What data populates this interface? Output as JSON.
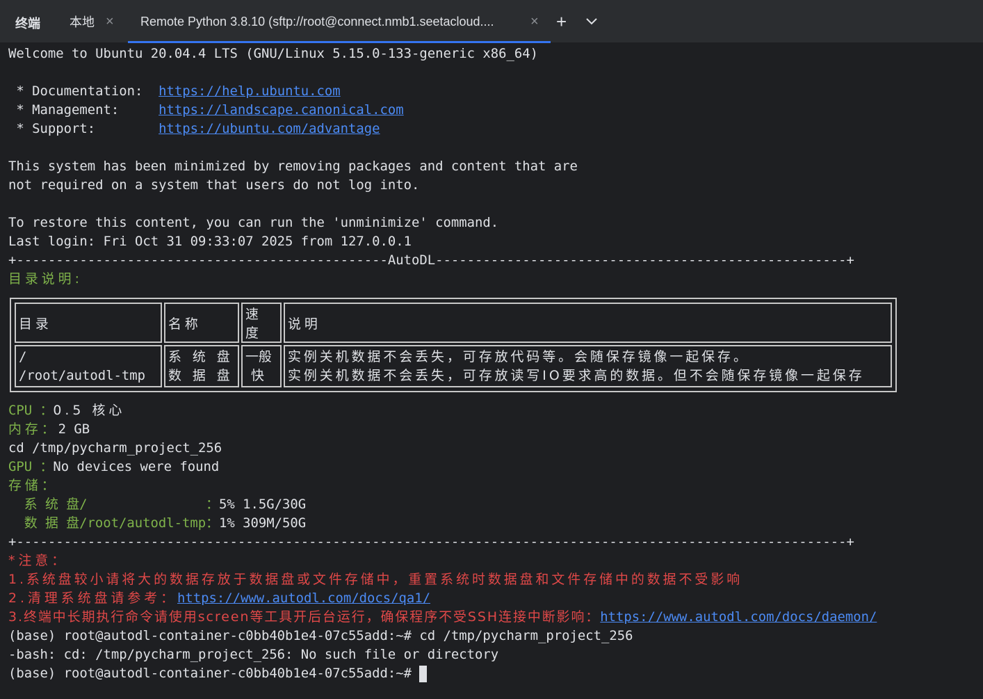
{
  "tabbar": {
    "title": "终端",
    "tabs": [
      {
        "label": "本地",
        "close": "×"
      },
      {
        "label": "Remote Python 3.8.10 (sftp://root@connect.nmb1.seetacloud....",
        "close": "×"
      }
    ],
    "new_tab": "+"
  },
  "terminal": {
    "welcome": "Welcome to Ubuntu 20.04.4 LTS (GNU/Linux 5.15.0-133-generic x86_64)",
    "docs_label": " * Documentation:  ",
    "docs_url": "https://help.ubuntu.com",
    "mgmt_label": " * Management:     ",
    "mgmt_url": "https://landscape.canonical.com",
    "support_label": " * Support:        ",
    "support_url": "https://ubuntu.com/advantage",
    "min1": "This system has been minimized by removing packages and content that are",
    "min2": "not required on a system that users do not log into.",
    "restore": "To restore this content, you can run the 'unminimize' command.",
    "last_login": "Last login: Fri Oct 31 09:33:07 2025 from 127.0.0.1",
    "sep_top": "+-----------------------------------------------AutoDL----------------------------------------------------+",
    "dir_title": "目录说明:",
    "table": {
      "h_dir": "目录",
      "h_name": "名称",
      "h_speed": "速度",
      "h_desc": "说明",
      "r1_dir": "/",
      "r2_dir": "/root/autodl-tmp",
      "r1_name": "系 统 盘",
      "r2_name": "数 据 盘",
      "r1_speed": "一般",
      "r2_speed": "快",
      "r1_desc": "实例关机数据不会丢失，可存放代码等。会随保存镜像一起保存。",
      "r2_desc": "实例关机数据不会丢失，可存放读写IO要求高的数据。但不会随保存镜像一起保存"
    },
    "cpu_label": "CPU ：",
    "cpu_value": "0.5 核心",
    "mem_label": "内存：",
    "mem_value": "2 GB",
    "cd_cmd": "cd /tmp/pycharm_project_256",
    "gpu_label": "GPU ：",
    "gpu_value": "No devices were found",
    "storage_label": "存储：",
    "sys_label": "  系 统 盘/               ：",
    "sys_value": "5% 1.5G/30G",
    "data_label": "  数 据 盘/root/autodl-tmp：",
    "data_value": "1% 309M/50G",
    "sep_bottom": "+---------------------------------------------------------------------------------------------------------+",
    "note_title": "*注意：",
    "note1": "1.系统盘较小请将大的数据存放于数据盘或文件存储中，重置系统时数据盘和文件存储中的数据不受影响",
    "note2_text": "2.清理系统盘请参考：",
    "note2_url": "https://www.autodl.com/docs/qa1/",
    "note3_text": "3.终端中长期执行命令请使用screen等工具开后台运行，确保程序不受SSH连接中断影响：",
    "note3_url": "https://www.autodl.com/docs/daemon/",
    "prompt1": "(base) root@autodl-container-c0bb40b1e4-07c55add:~# cd /tmp/pycharm_project_256",
    "error": "-bash: cd: /tmp/pycharm_project_256: No such file or directory",
    "prompt2": "(base) root@autodl-container-c0bb40b1e4-07c55add:~# "
  }
}
